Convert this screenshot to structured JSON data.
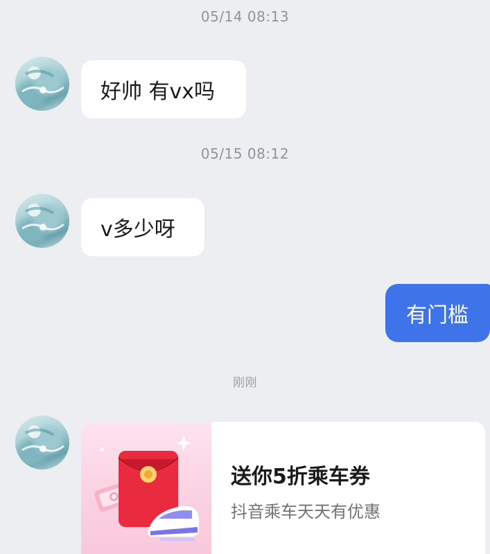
{
  "messages": [
    {
      "timestamp": "05/14 08:13",
      "text": "好帅 有vx吗"
    },
    {
      "timestamp": "05/15 08:12",
      "text": "v多少呀"
    },
    {
      "text": "有门槛"
    },
    {
      "timestamp": "刚刚"
    }
  ],
  "card": {
    "title": "送你5折乘车券",
    "subtitle": "抖音乘车天天有优惠"
  },
  "colors": {
    "background": "#eceef1",
    "my_bubble": "#3e73ea",
    "their_bubble": "#ffffff",
    "timestamp": "#8f9499"
  },
  "icons": [
    "user-avatar",
    "red-envelope-icon",
    "train-icon",
    "coupon-ticket-icon"
  ]
}
